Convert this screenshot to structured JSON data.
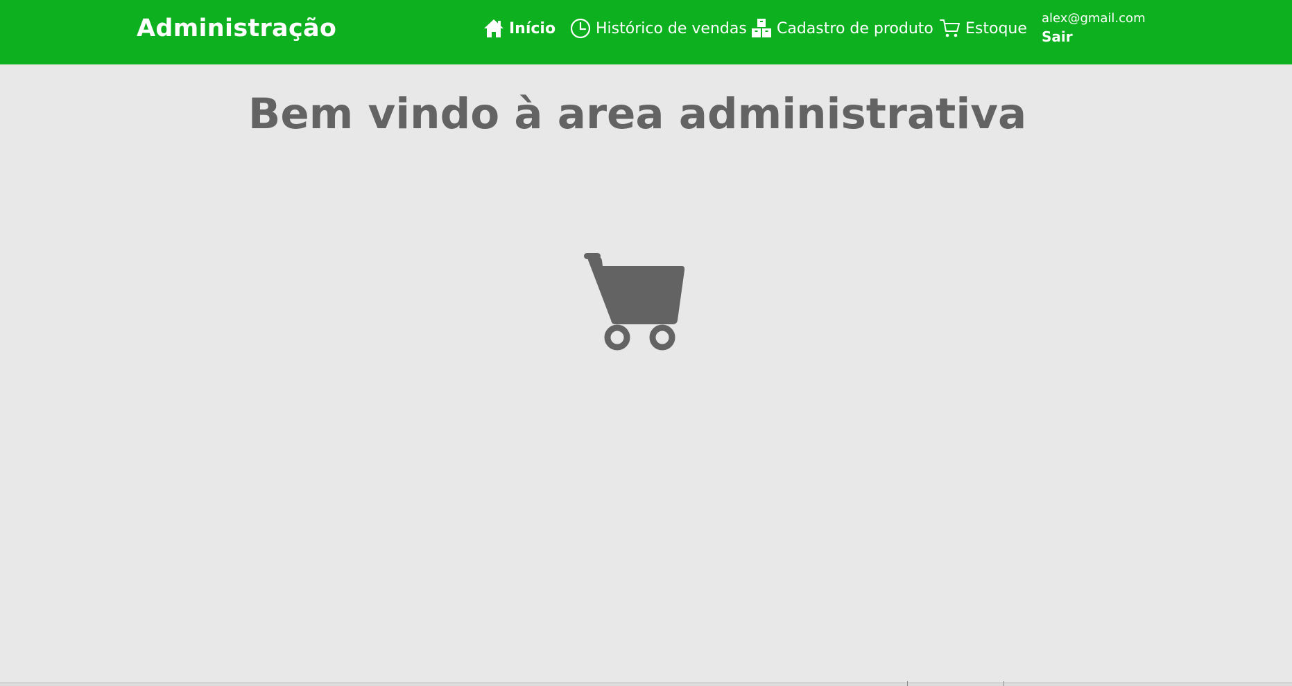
{
  "app": {
    "brand": "Administração"
  },
  "nav": {
    "items": [
      {
        "label": "Início",
        "icon": "home-icon",
        "active": true
      },
      {
        "label": "Histórico de vendas",
        "icon": "clock-icon",
        "active": false
      },
      {
        "label": "Cadastro de produto",
        "icon": "boxes-icon",
        "active": false
      },
      {
        "label": "Estoque",
        "icon": "cart-outline-icon",
        "active": false
      }
    ]
  },
  "user": {
    "email": "alex@gmail.com",
    "logout_label": "Sair"
  },
  "main": {
    "welcome": "Bem vindo à area administrativa",
    "hero_icon": "shopping-cart-icon"
  },
  "colors": {
    "header": "#0db120",
    "background": "#e8e8e8",
    "heading": "#636363"
  }
}
